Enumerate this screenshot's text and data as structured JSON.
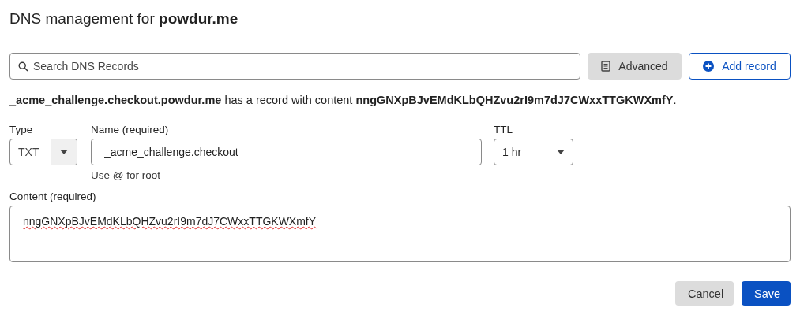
{
  "title": "DNS management for **powdur.me**",
  "search": {
    "placeholder": "Search DNS Records"
  },
  "toolbar_buttons": [
    {
      "label": "Advanced",
      "kind": "secondary"
    },
    {
      "label": "Add record",
      "kind": "outline"
    }
  ],
  "notice": "**_acme_challenge.checkout.powdur.me** has a record with content **nngGNXpBJvEMdKLbQHZvu2rI9m7dJ7CWxxTTGKWXmfY**.",
  "form": {
    "type": {
      "label": "Type",
      "value": "TXT"
    },
    "name": {
      "label": "Name (required)",
      "value": "_acme_challenge.checkout",
      "hint": "Use @ for root"
    },
    "ttl": {
      "label": "TTL",
      "value": "1 hr"
    },
    "content": {
      "label": "Content (required)",
      "value": "nngGNXpBJvEMdKLbQHZvu2rI9m7dJ7CWxxTTGKWXmfY",
      "spelling_error": true
    }
  },
  "actions": [
    {
      "label": "Cancel",
      "kind": "secondary"
    },
    {
      "label": "Save",
      "kind": "primary"
    }
  ]
}
